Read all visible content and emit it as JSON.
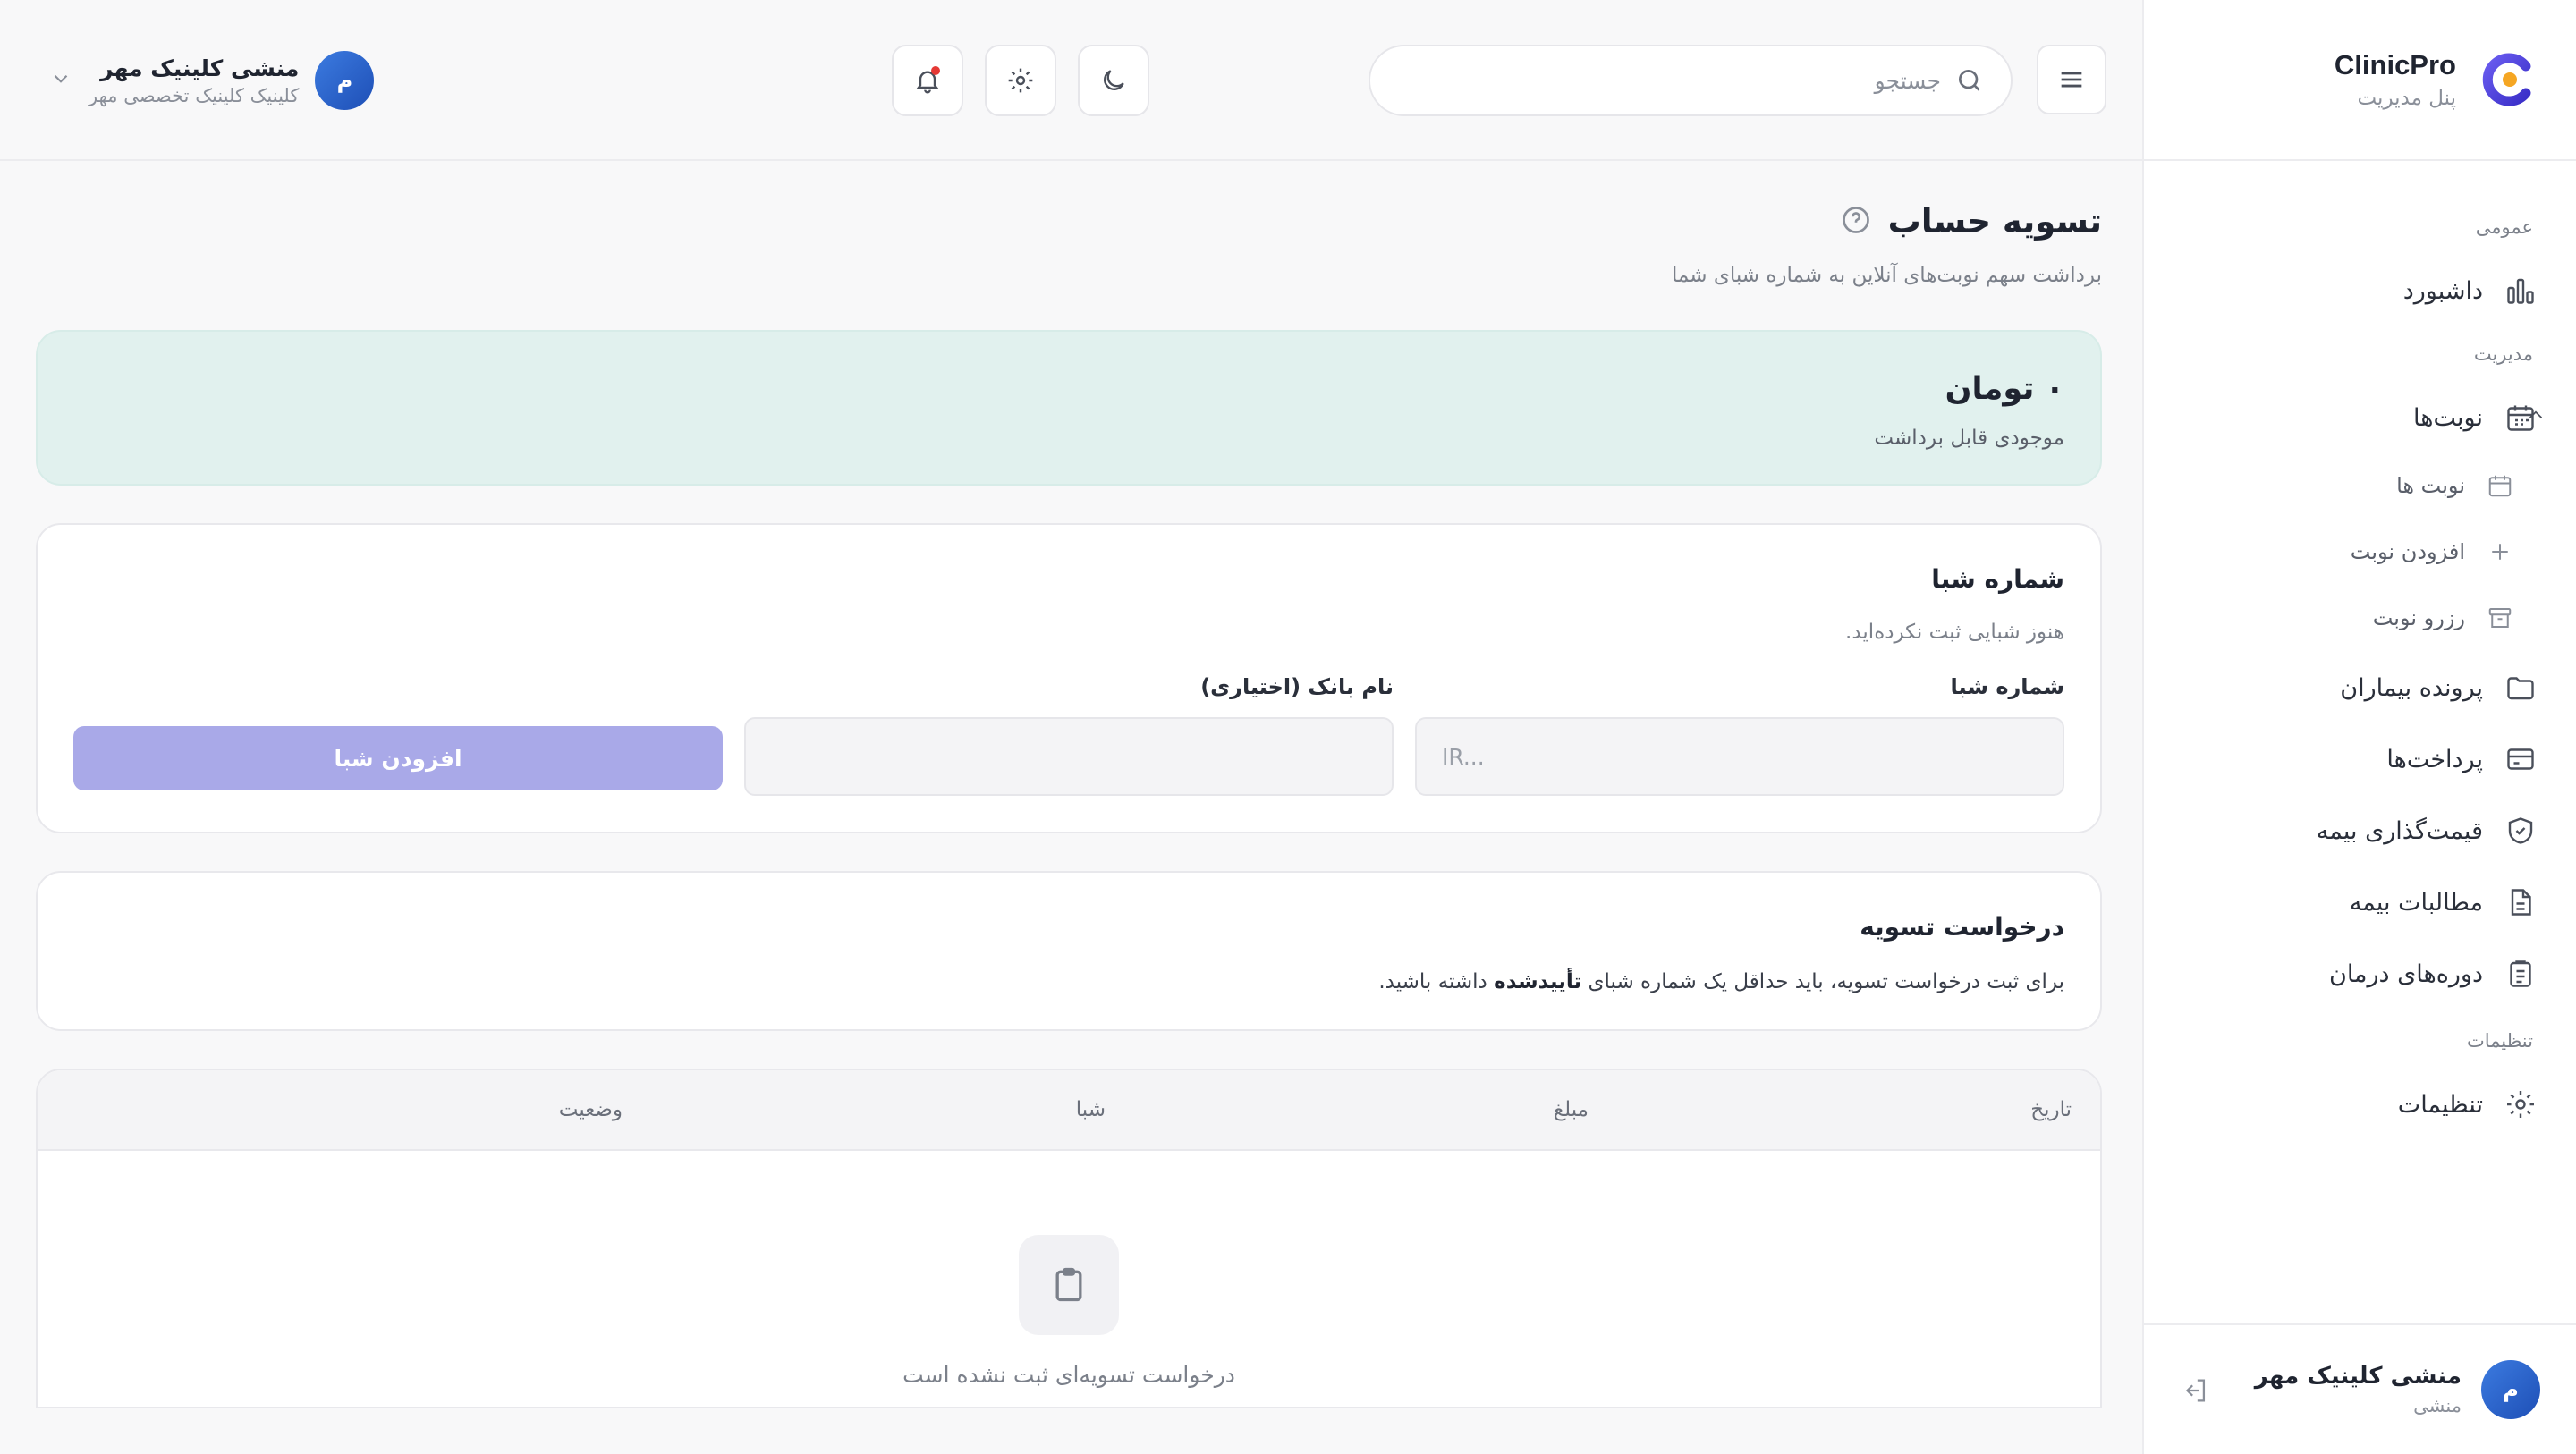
{
  "brand": {
    "name": "ClinicPro",
    "subtitle": "پنل مدیریت"
  },
  "sidebar": {
    "sections": {
      "general": "عمومی",
      "management": "مدیریت",
      "settings": "تنظیمات"
    },
    "items": {
      "dashboard": "داشبورد",
      "appointments": "نوبت‌ها",
      "appointments_sub": [
        "نوبت ها",
        "افزودن نوبت",
        "رزرو نوبت"
      ],
      "patients": "پرونده بیماران",
      "payments": "پرداخت‌ها",
      "insurance_pricing": "قیمت‌گذاری بیمه",
      "insurance_claims": "مطالبات بیمه",
      "treatment_courses": "دوره‌های درمان",
      "settings": "تنظیمات"
    },
    "user": {
      "name": "منشی کلینیک مهر",
      "role": "منشی",
      "initial": "م"
    }
  },
  "header": {
    "search_placeholder": "جستجو",
    "user": {
      "name": "منشی کلینیک مهر",
      "clinic": "کلینیک کلینیک تخصصی مهر",
      "initial": "م"
    }
  },
  "page": {
    "title": "تسویه حساب",
    "subtitle": "برداشت سهم نوبت‌های آنلاین به شماره شبای شما"
  },
  "balance": {
    "amount": "۰ تومان",
    "label": "موجودی قابل برداشت"
  },
  "sheba_card": {
    "title": "شماره شبا",
    "empty_note": "هنوز شبایی ثبت نکرده‌اید.",
    "sheba_label": "شماره شبا",
    "sheba_placeholder": "IR...",
    "bank_label": "نام بانک (اختیاری)",
    "bank_placeholder": "",
    "add_button": "افزودن شبا"
  },
  "settlement_card": {
    "title": "درخواست تسویه",
    "text_before": "برای ثبت درخواست تسویه، باید حداقل یک شماره شبای",
    "text_bold": "تأییدشده",
    "text_after": "داشته باشید."
  },
  "table": {
    "columns": [
      "تاریخ",
      "مبلغ",
      "شبا",
      "وضعیت"
    ],
    "empty": "درخواست تسویه‌ای ثبت نشده است"
  },
  "colors": {
    "accent": "#a9a9e8",
    "balance_bg": "#e1f1ee",
    "avatar": "#2f66cc",
    "notification_dot": "#e53935"
  }
}
